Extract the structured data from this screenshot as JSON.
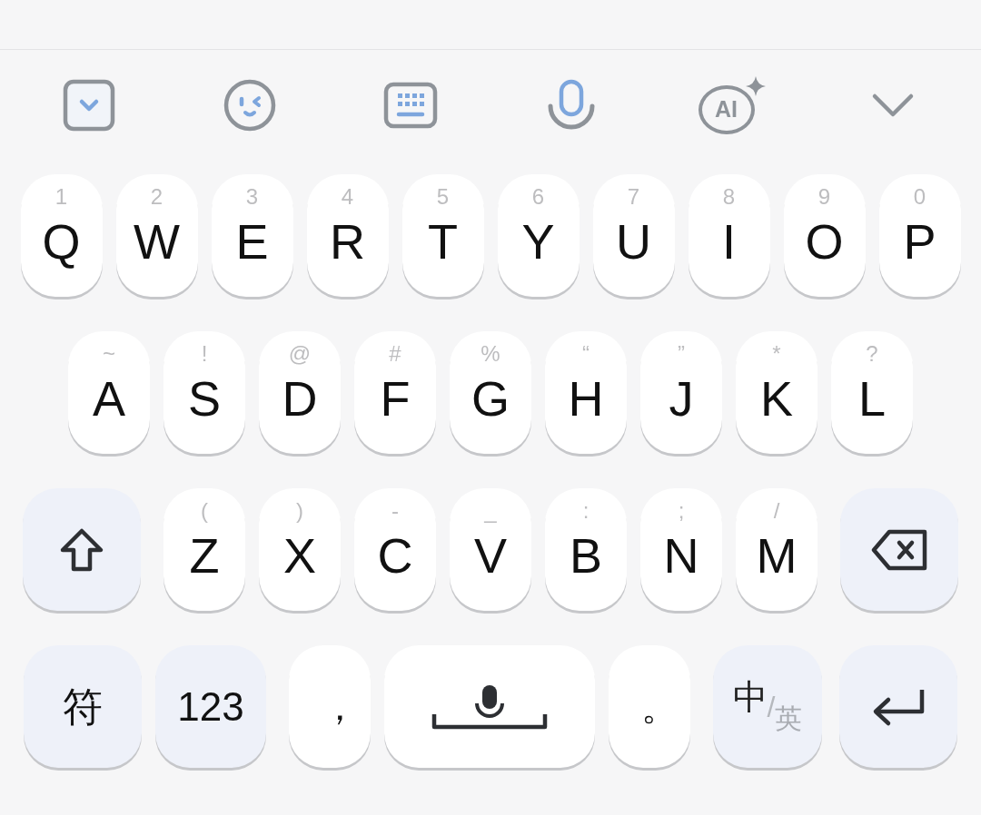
{
  "toolbar": [
    {
      "kind": "menu"
    },
    {
      "kind": "emoji"
    },
    {
      "kind": "keyboard"
    },
    {
      "kind": "voice"
    },
    {
      "kind": "ai",
      "label": "AI"
    },
    {
      "kind": "hide"
    }
  ],
  "rows": [
    {
      "keys": [
        {
          "kind": "letter",
          "label": "Q",
          "hint": "1"
        },
        {
          "kind": "letter",
          "label": "W",
          "hint": "2"
        },
        {
          "kind": "letter",
          "label": "E",
          "hint": "3"
        },
        {
          "kind": "letter",
          "label": "R",
          "hint": "4"
        },
        {
          "kind": "letter",
          "label": "T",
          "hint": "5"
        },
        {
          "kind": "letter",
          "label": "Y",
          "hint": "6"
        },
        {
          "kind": "letter",
          "label": "U",
          "hint": "7"
        },
        {
          "kind": "letter",
          "label": "I",
          "hint": "8"
        },
        {
          "kind": "letter",
          "label": "O",
          "hint": "9"
        },
        {
          "kind": "letter",
          "label": "P",
          "hint": "0"
        }
      ]
    },
    {
      "keys": [
        {
          "kind": "letter",
          "label": "A",
          "hint": "~"
        },
        {
          "kind": "letter",
          "label": "S",
          "hint": "!"
        },
        {
          "kind": "letter",
          "label": "D",
          "hint": "@"
        },
        {
          "kind": "letter",
          "label": "F",
          "hint": "#"
        },
        {
          "kind": "letter",
          "label": "G",
          "hint": "%"
        },
        {
          "kind": "letter",
          "label": "H",
          "hint": "“"
        },
        {
          "kind": "letter",
          "label": "J",
          "hint": "”"
        },
        {
          "kind": "letter",
          "label": "K",
          "hint": "*"
        },
        {
          "kind": "letter",
          "label": "L",
          "hint": "?"
        }
      ]
    },
    {
      "keys": [
        {
          "kind": "shift"
        },
        {
          "kind": "letter",
          "label": "Z",
          "hint": "("
        },
        {
          "kind": "letter",
          "label": "X",
          "hint": ")"
        },
        {
          "kind": "letter",
          "label": "C",
          "hint": "-"
        },
        {
          "kind": "letter",
          "label": "V",
          "hint": "_"
        },
        {
          "kind": "letter",
          "label": "B",
          "hint": ":"
        },
        {
          "kind": "letter",
          "label": "N",
          "hint": ";"
        },
        {
          "kind": "letter",
          "label": "M",
          "hint": "/"
        },
        {
          "kind": "backspace"
        }
      ]
    },
    {
      "keys": [
        {
          "kind": "symbol",
          "label": "符"
        },
        {
          "kind": "number",
          "label": "123"
        },
        {
          "kind": "punct",
          "label": "，"
        },
        {
          "kind": "space"
        },
        {
          "kind": "punct",
          "label": "。"
        },
        {
          "kind": "lang",
          "label": "中",
          "separator": "/",
          "alt_label": "英"
        },
        {
          "kind": "enter"
        }
      ]
    }
  ]
}
